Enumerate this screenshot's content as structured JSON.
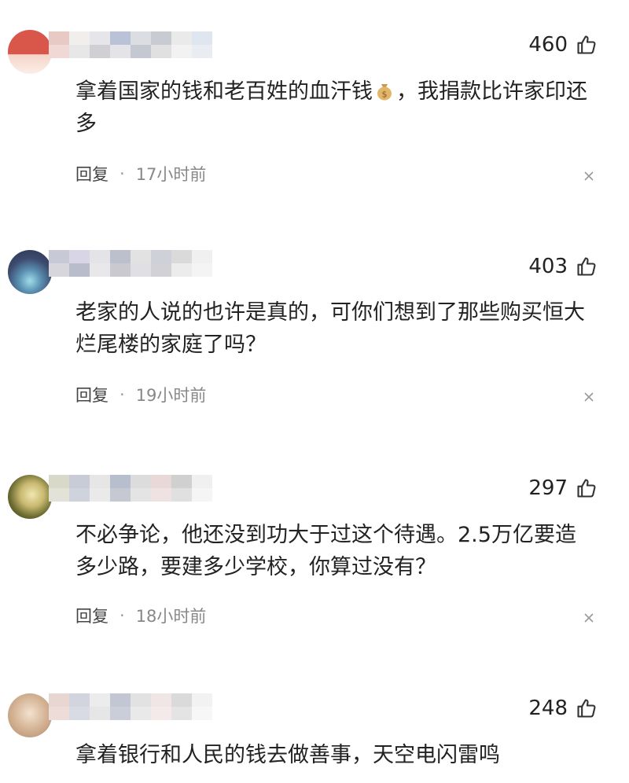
{
  "comments": [
    {
      "likes": "460",
      "text_before": "拿着国家的钱和老百姓的血汗钱",
      "emoji": "money-bag",
      "text_after": "，我捐款比许家印还多",
      "reply_label": "回复",
      "separator": "·",
      "time": "17小时前",
      "avatar_colors": [
        "#d9574a",
        "#f2c6b8"
      ]
    },
    {
      "likes": "403",
      "text_before": "老家的人说的也许是真的，可你们想到了那些购买恒大烂尾楼的家庭了吗？",
      "text_after": "",
      "reply_label": "回复",
      "separator": "·",
      "time": "19小时前",
      "avatar_colors": [
        "#3c4a6e",
        "#8fd0e0"
      ]
    },
    {
      "likes": "297",
      "text_before": "不必争论，他还没到功大于过这个待遇。2.5万亿要造多少路，要建多少学校，你算过没有？",
      "text_after": "",
      "reply_label": "回复",
      "separator": "·",
      "time": "18小时前",
      "avatar_colors": [
        "#5a5a2a",
        "#e8dca0"
      ]
    },
    {
      "likes": "248",
      "text_before": "拿着银行和人民的钱去做善事，天空电闪雷鸣",
      "text_after": "",
      "avatar_colors": [
        "#c8a888",
        "#f0dcc8"
      ]
    }
  ],
  "icons": {
    "like": "thumbs-up-icon",
    "close": "close-icon",
    "emoji": "money-bag-icon"
  }
}
